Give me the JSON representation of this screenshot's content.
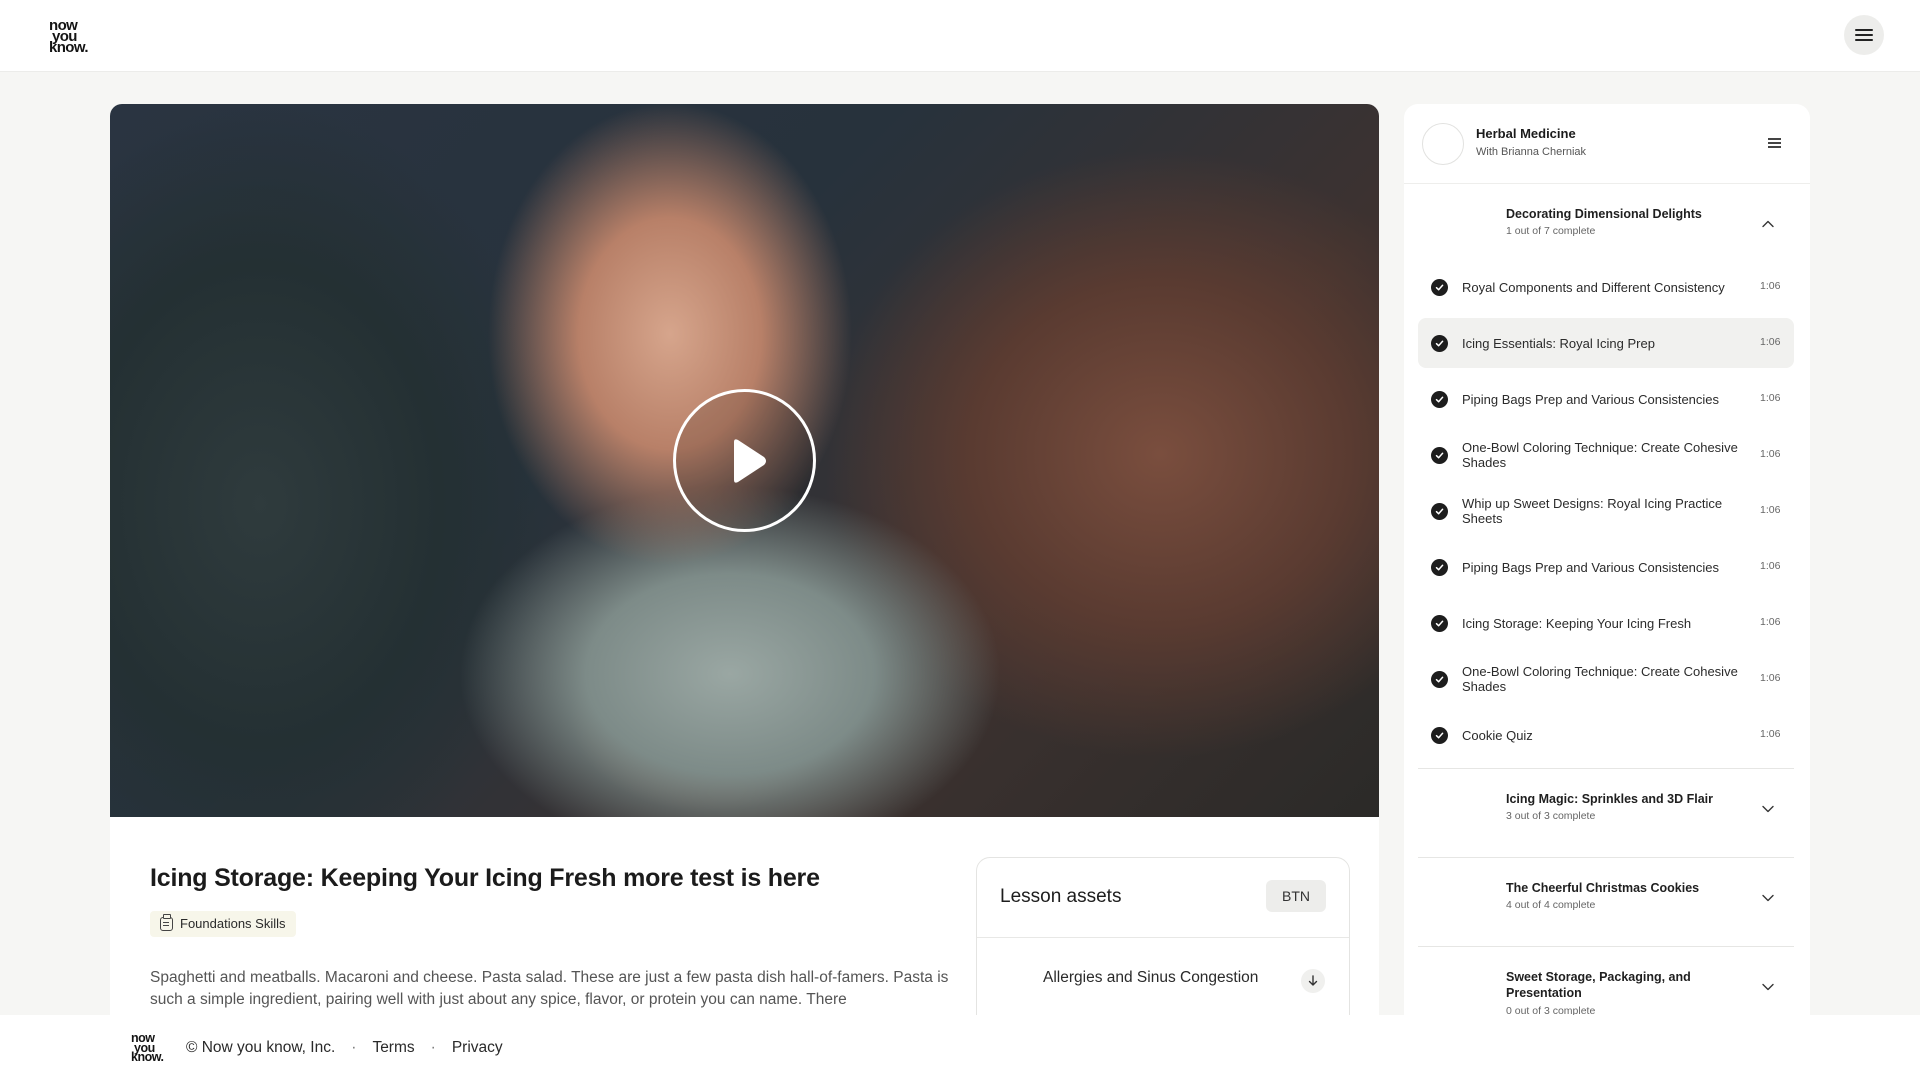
{
  "brand": {
    "logo_lines": [
      "now",
      "you",
      "know."
    ]
  },
  "lesson": {
    "title": "Icing Storage: Keeping Your Icing Fresh more test is here",
    "tag": "Foundations Skills",
    "description": "Spaghetti and meatballs. Macaroni and cheese. Pasta salad. These are just a few pasta dish hall-of-famers. Pasta is such a simple ingredient, pairing well with just about any spice, flavor, or protein you can name. There"
  },
  "assets": {
    "title": "Lesson assets",
    "button_label": "BTN",
    "items": [
      {
        "name": "Allergies and Sinus Congestion"
      }
    ]
  },
  "course": {
    "title": "Herbal Medicine",
    "author": "With Brianna Cherniak",
    "sections": [
      {
        "title": "Decorating Dimensional Delights",
        "progress": "1 out of 7 complete",
        "expanded": true,
        "lessons": [
          {
            "name": "Royal Components and Different Consistency",
            "duration": "1:06",
            "completed": true
          },
          {
            "name": "Icing Essentials: Royal Icing Prep",
            "duration": "1:06",
            "completed": true,
            "active": true
          },
          {
            "name": "Piping Bags Prep and Various Consistencies",
            "duration": "1:06",
            "completed": true
          },
          {
            "name": "One-Bowl Coloring Technique: Create Cohesive Shades",
            "duration": "1:06",
            "completed": true
          },
          {
            "name": "Whip up Sweet Designs: Royal Icing Practice Sheets",
            "duration": "1:06",
            "completed": true
          },
          {
            "name": "Piping Bags Prep and Various Consistencies",
            "duration": "1:06",
            "completed": true
          },
          {
            "name": "Icing Storage: Keeping Your Icing Fresh",
            "duration": "1:06",
            "completed": true
          },
          {
            "name": "One-Bowl Coloring Technique: Create Cohesive Shades",
            "duration": "1:06",
            "completed": true
          },
          {
            "name": "Cookie Quiz",
            "duration": "1:06",
            "completed": true
          }
        ]
      },
      {
        "title": "Icing Magic: Sprinkles and 3D Flair",
        "progress": "3 out of 3 complete",
        "expanded": false
      },
      {
        "title": "The Cheerful Christmas Cookies",
        "progress": "4 out of 4 complete",
        "expanded": false
      },
      {
        "title": "Sweet Storage, Packaging, and Presentation",
        "progress": "0 out of 3 complete",
        "expanded": false
      }
    ]
  },
  "footer": {
    "copyright": "© Now you know, Inc.",
    "separator": "·",
    "terms": "Terms",
    "privacy": "Privacy"
  },
  "colors": {
    "accent_dark": "#1d1d1d",
    "tag_bg": "#f7f6ea",
    "page_bg": "#f6f6f4"
  }
}
